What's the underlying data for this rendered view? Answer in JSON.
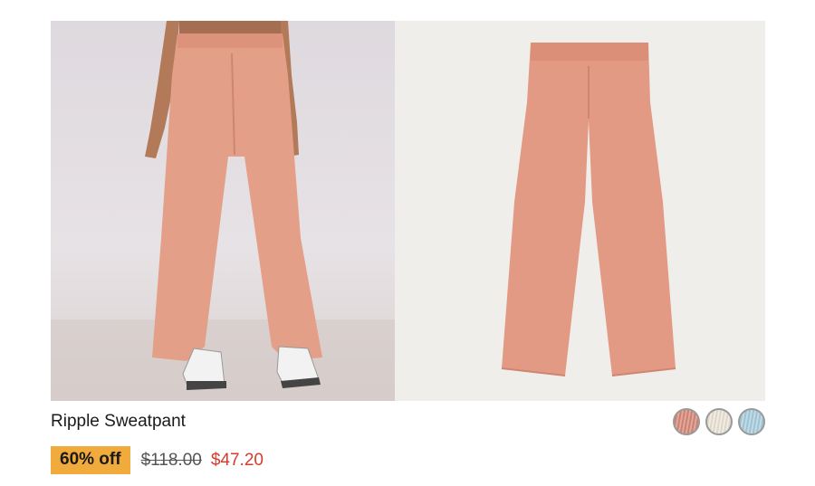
{
  "product": {
    "title": "Ripple Sweatpant",
    "discount_badge": "60% off",
    "original_price": "$118.00",
    "sale_price": "$47.20"
  },
  "images": [
    {
      "name": "model-photo",
      "alt": "Model wearing wide-leg sweatpant"
    },
    {
      "name": "flat-lay-photo",
      "alt": "Sweatpant flat lay"
    }
  ],
  "swatches": [
    {
      "name": "salmon",
      "color": "#d98a7a"
    },
    {
      "name": "cream",
      "color": "#ece4d6"
    },
    {
      "name": "light-blue",
      "color": "#a9cfdf"
    }
  ],
  "colors": {
    "badge": "#f1ab3c",
    "sale_price": "#d83a2b",
    "pant": "#e4a08b"
  }
}
